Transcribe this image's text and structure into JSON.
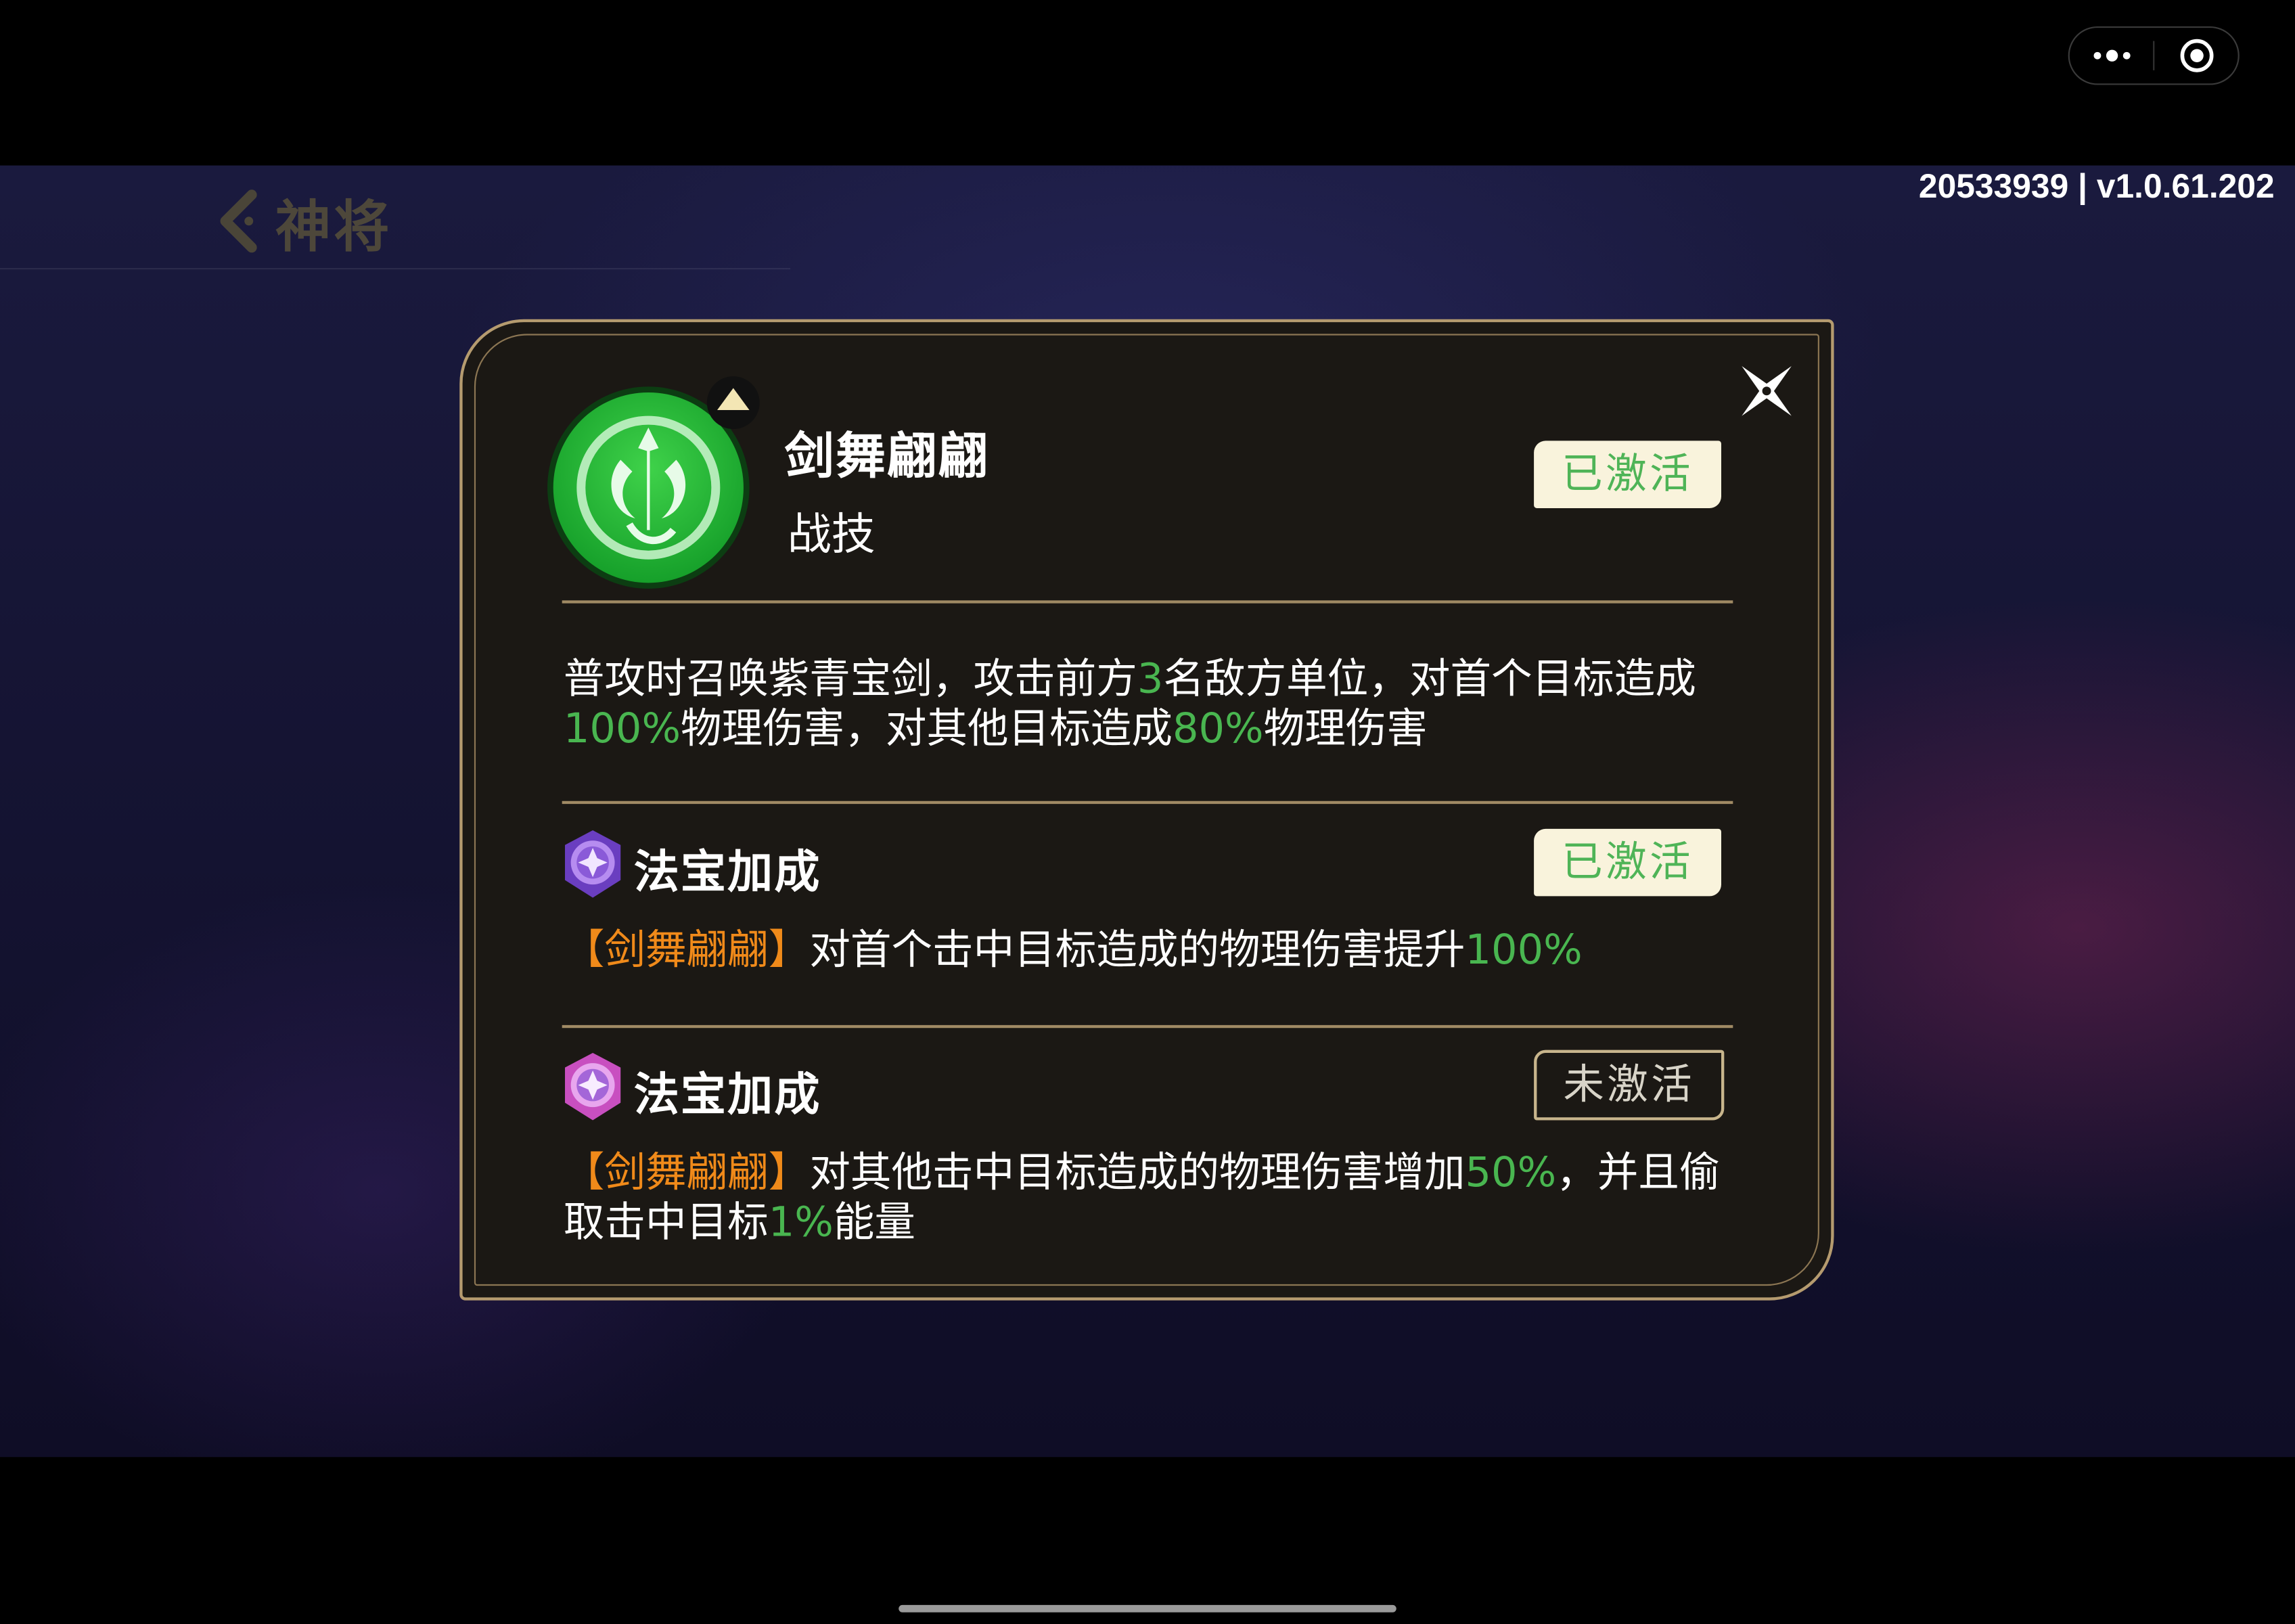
{
  "system": {
    "version": "20533939 | v1.0.61.202",
    "more_icon": "more-dots-icon",
    "record_icon": "record-circle-icon"
  },
  "header": {
    "back_label": "神将",
    "back_icon": "chevron-left-icon"
  },
  "dialog": {
    "close_icon": "close-x-icon",
    "skill": {
      "name": "剑舞翩翩",
      "type": "战技",
      "status": "已激活",
      "icon": "sword-emblem-icon",
      "badge_icon": "level-up-arrow-icon",
      "description": {
        "p1": "普攻时召唤紫青宝剑，攻击前方",
        "v1": "3",
        "p2": "名敌方单位，对首个目标造成",
        "v2": "100%",
        "p3": "物理伤害，对其他目标造成",
        "v3": "80%",
        "p4": "物理伤害"
      }
    },
    "bonuses": [
      {
        "title": "法宝加成",
        "status": "已激活",
        "icon": "treasure-gem-icon",
        "skill_ref": "【剑舞翩翩】",
        "p1": "对首个击中目标造成的物理伤害提升",
        "v1": "100%"
      },
      {
        "title": "法宝加成",
        "status": "未激活",
        "icon": "treasure-gem-icon",
        "skill_ref": "【剑舞翩翩】",
        "p1": "对其他击中目标造成的物理伤害增加",
        "v1": "50%",
        "p2": "，并且偷取击中目标",
        "v2": "1%",
        "p3": "能量"
      }
    ]
  },
  "colors": {
    "highlight_green": "#49b650",
    "skill_orange": "#f08a1a",
    "frame_gold": "#b59b6f",
    "dialog_bg": "#1b1814",
    "active_badge_bg": "#f9f3dc"
  }
}
